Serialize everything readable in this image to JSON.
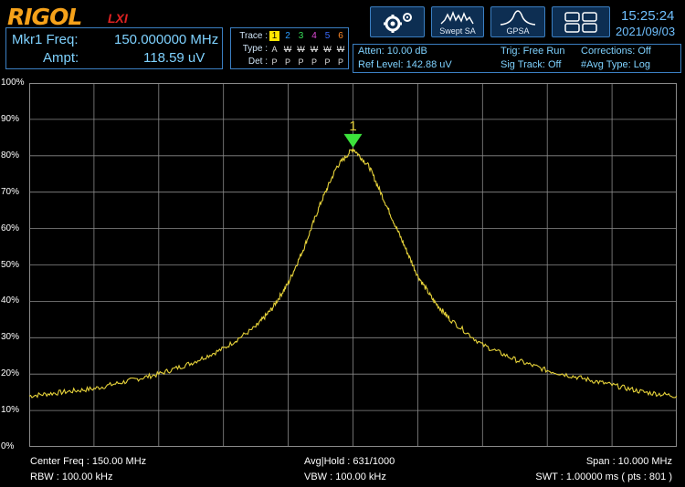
{
  "header": {
    "brand": "RIGOL",
    "brand_sub": "LXI",
    "modes": [
      {
        "name": "Swept SA"
      },
      {
        "name": "GPSA"
      }
    ],
    "time": "15:25:24",
    "date": "2021/09/03"
  },
  "marker": {
    "freq_label": "Mkr1 Freq:",
    "freq_value": "150.000000 MHz",
    "ampt_label": "Ampt:",
    "ampt_value": "118.59 uV",
    "number": "1"
  },
  "trace": {
    "trace_label": "Trace :",
    "type_label": "Type :",
    "det_label": "Det :",
    "numbers": [
      "1",
      "2",
      "3",
      "4",
      "5",
      "6"
    ],
    "colors": [
      "#ffe600",
      "#2a9dff",
      "#37e05a",
      "#e04ad8",
      "#3a6bff",
      "#ff8a2a"
    ],
    "types": [
      "A",
      "W",
      "W",
      "W",
      "W",
      "W"
    ],
    "dets": [
      "P",
      "P",
      "P",
      "P",
      "P",
      "P"
    ]
  },
  "status": {
    "atten": "Atten: 10.00 dB",
    "ref_level": "Ref Level: 142.88 uV",
    "trig": "Trig: Free Run",
    "sig_track": "Sig Track: Off",
    "corrections": "Corrections: Off",
    "avg_type": "#Avg Type: Log"
  },
  "y_axis": [
    "100%",
    "90%",
    "80%",
    "70%",
    "60%",
    "50%",
    "40%",
    "30%",
    "20%",
    "10%",
    "0%"
  ],
  "footer": {
    "center_freq": "Center Freq : 150.00 MHz",
    "rbw": "RBW : 100.00 kHz",
    "avg_hold": "Avg|Hold : 631/1000",
    "vbw": "VBW : 100.00 kHz",
    "span": "Span : 10.000 MHz",
    "swt": "SWT : 1.00000 ms ( pts : 801 )"
  },
  "colors": {
    "trace": "#e6d23a",
    "grid": "#8a8a8a",
    "marker": "#3ce23c",
    "accent": "#6fc0ff"
  },
  "chart_data": {
    "type": "line",
    "xlabel": "",
    "ylabel": "",
    "x_range_mhz": [
      145,
      155
    ],
    "ylim": [
      0,
      100
    ],
    "y_unit": "%",
    "grid": true,
    "series": [
      {
        "x": [
          145,
          145.5,
          146,
          146.5,
          147,
          147.5,
          148,
          148.5,
          148.75,
          149,
          149.25,
          149.5,
          149.75,
          150,
          150.25,
          150.5,
          150.75,
          151,
          151.25,
          151.5,
          152,
          152.5,
          153,
          153.5,
          154,
          154.5,
          155
        ],
        "values": [
          14,
          15,
          16,
          18,
          20,
          23,
          27,
          33,
          38,
          45,
          55,
          67,
          77,
          82,
          77,
          67,
          57,
          47,
          40,
          35,
          28,
          24,
          21,
          19,
          17,
          15,
          14
        ]
      }
    ],
    "marker": {
      "label": "1",
      "x": 150,
      "value": 82
    }
  }
}
